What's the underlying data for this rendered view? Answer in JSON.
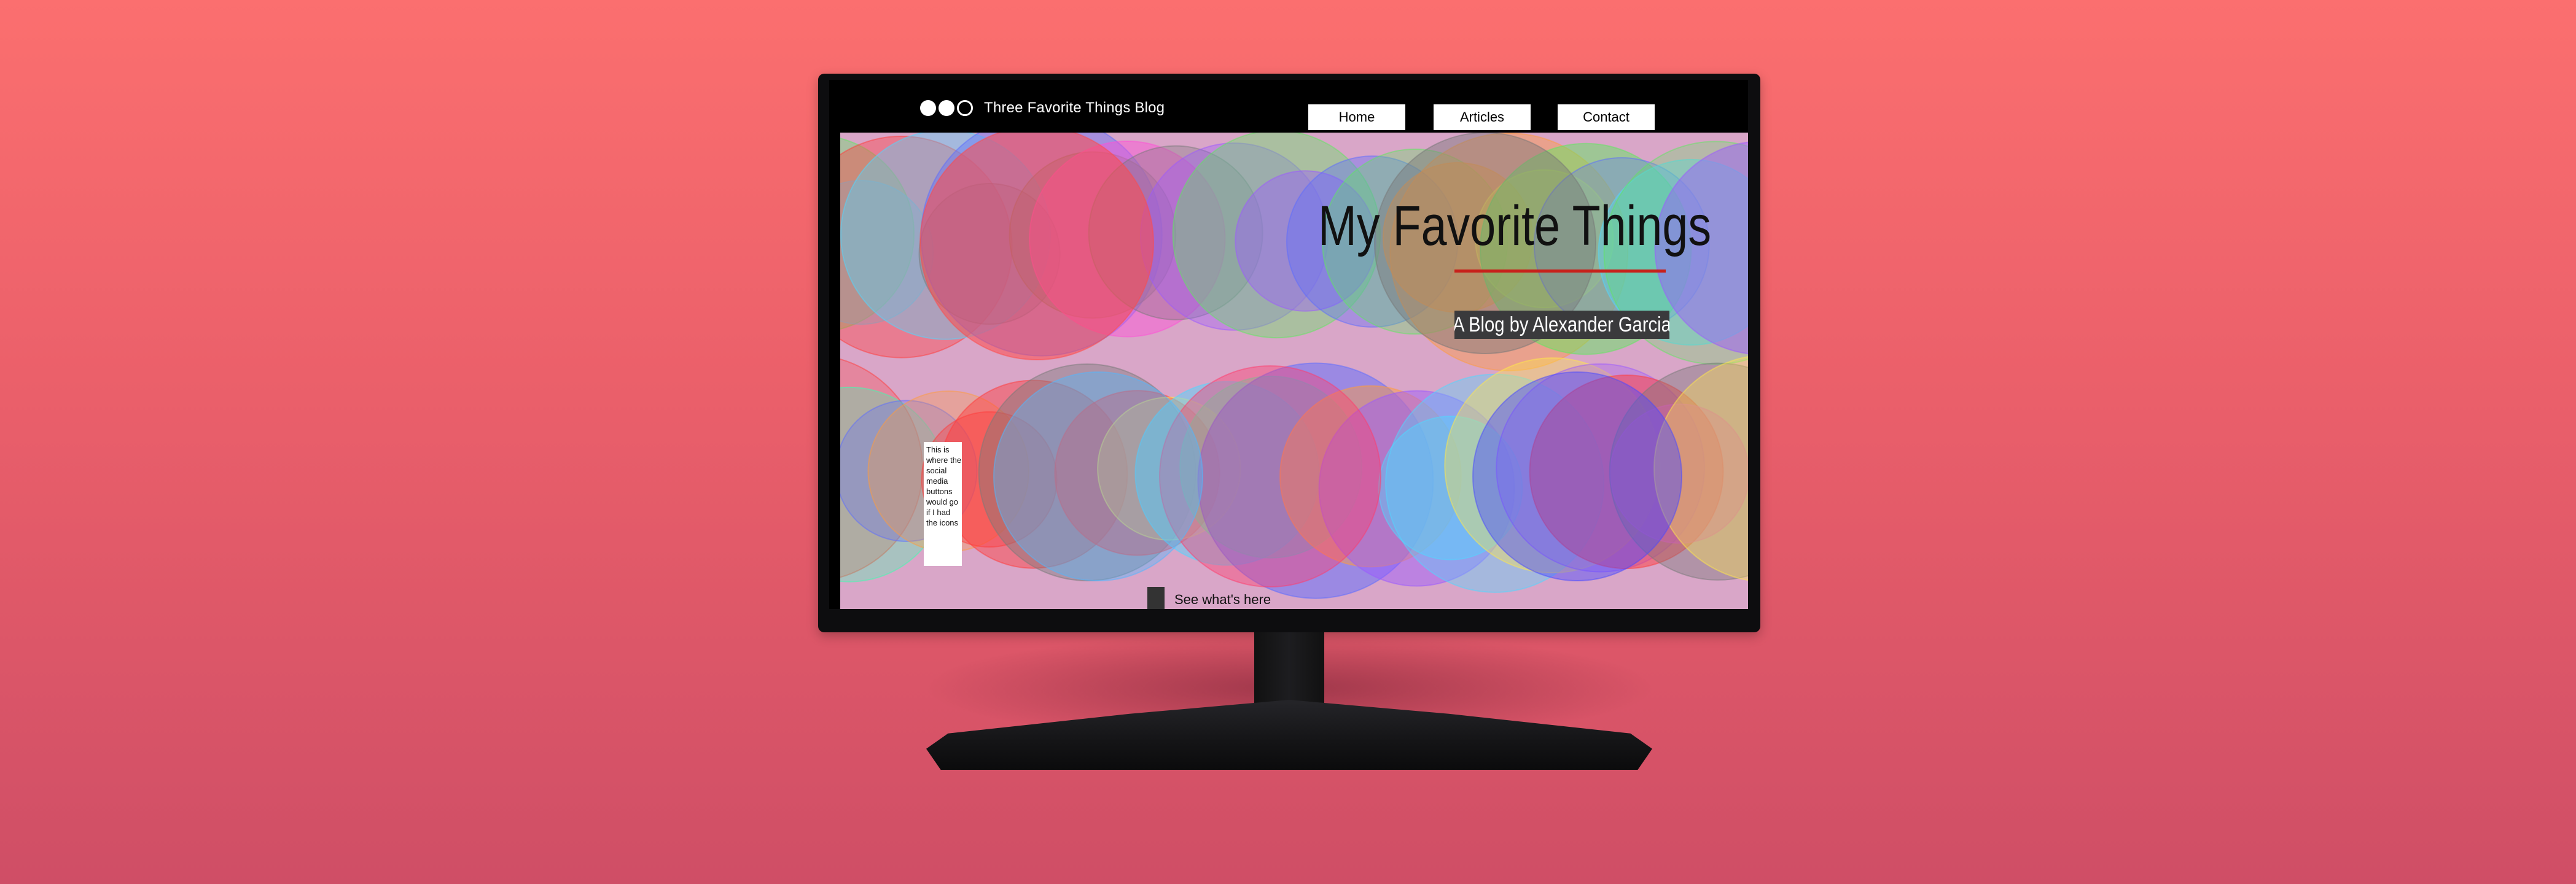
{
  "site": {
    "title": "Three Favorite Things Blog",
    "nav": [
      "Home",
      "Articles",
      "Contact"
    ]
  },
  "hero": {
    "headline": "My Favorite Things",
    "byline": "A Blog by Alexander Garcia",
    "social_placeholder": "This is where the social media buttons would go if I had the icons",
    "cta": "See what's here"
  },
  "colors": {
    "background": "#f2676c",
    "accent_underline": "#c8201a",
    "byline_bg": "#3a3a3c"
  },
  "icons": [
    "logo-filled-circle-icon",
    "logo-filled-circle-icon",
    "logo-hollow-circle-icon"
  ]
}
